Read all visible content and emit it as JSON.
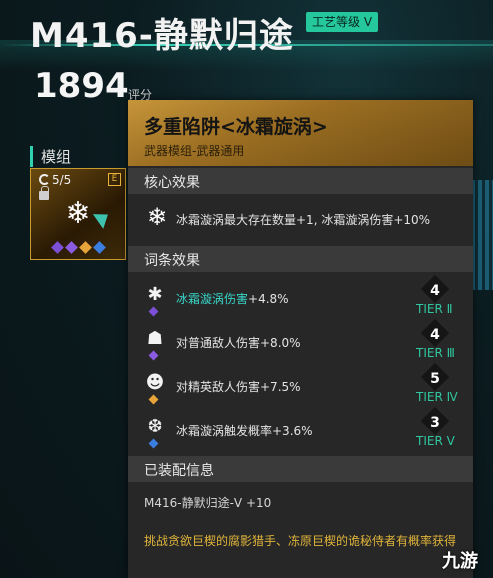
{
  "header": {
    "weapon_title": "M416-静默归途",
    "craft_badge": "工艺等级 V",
    "score_value": "1894",
    "score_label": "评分"
  },
  "module_column": {
    "title": "模组",
    "count": "5/5",
    "grade": "E",
    "emblem_icon": "snowflake-icon",
    "gems": [
      "#7b4fd6",
      "#8a5be0",
      "#e7a43a",
      "#3b7de0"
    ]
  },
  "detail": {
    "module_name": "多重陷阱<冰霜旋涡>",
    "module_type": "武器模组-武器通用",
    "core_section_title": "核心效果",
    "core_effect": "冰霜漩涡最大存在数量+1, 冰霜漩涡伤害+10%",
    "affix_section_title": "词条效果",
    "affixes": [
      {
        "icon": "frost-icon",
        "highlight": "冰霜漩涡伤害",
        "text": "+4.8%",
        "tier_value": "4",
        "tier_label": "TIER Ⅱ",
        "pip_color": "#7b4fd6"
      },
      {
        "icon": "flame-mask-icon",
        "highlight": "",
        "text": "对普通敌人伤害+8.0%",
        "tier_value": "4",
        "tier_label": "TIER Ⅲ",
        "pip_color": "#8a5be0"
      },
      {
        "icon": "elite-mask-icon",
        "highlight": "",
        "text": "对精英敌人伤害+7.5%",
        "tier_value": "5",
        "tier_label": "TIER Ⅳ",
        "pip_color": "#e7a43a"
      },
      {
        "icon": "frost-trigger-icon",
        "highlight": "",
        "text": "冰霜漩涡触发概率+3.6%",
        "tier_value": "3",
        "tier_label": "TIER Ⅴ",
        "pip_color": "#3b7de0"
      }
    ],
    "equip_section_title": "已装配信息",
    "equip_info": "M416-静默归途-V +10",
    "source_text": "挑战贪欲巨楔的腐影猎手、冻原巨楔的诡秘侍者有概率获得"
  },
  "watermark": "九游",
  "colors": {
    "accent": "#2fd1b0",
    "gold": "#c6953a",
    "tier": "#2fc79f",
    "highlight": "#38d6c8",
    "source": "#e0b43a"
  }
}
